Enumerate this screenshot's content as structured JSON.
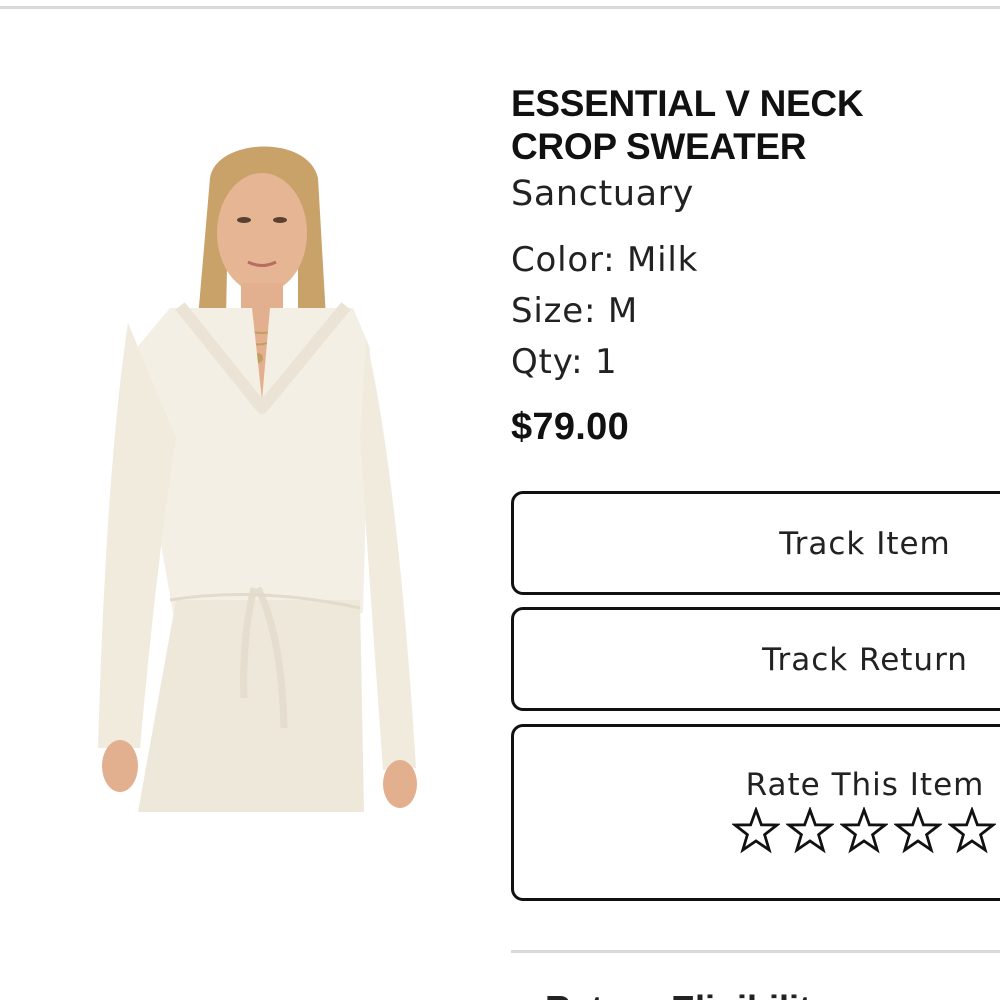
{
  "product": {
    "title_line1": "ESSENTIAL V NECK",
    "title_line2": "CROP SWEATER",
    "brand": "Sanctuary",
    "color": "Color: Milk",
    "size": "Size: M",
    "qty": "Qty: 1",
    "price": "$79.00"
  },
  "actions": {
    "track_item": "Track Item",
    "track_return": "Track Return",
    "rate_item": "Rate This Item"
  },
  "rating": {
    "stars_visible": 5,
    "value": 0
  },
  "next_section": {
    "label_partial": "Return Eligibility"
  },
  "colors": {
    "border": "#111111",
    "divider": "#d9d9d9",
    "sweater": "#f4efe4"
  }
}
